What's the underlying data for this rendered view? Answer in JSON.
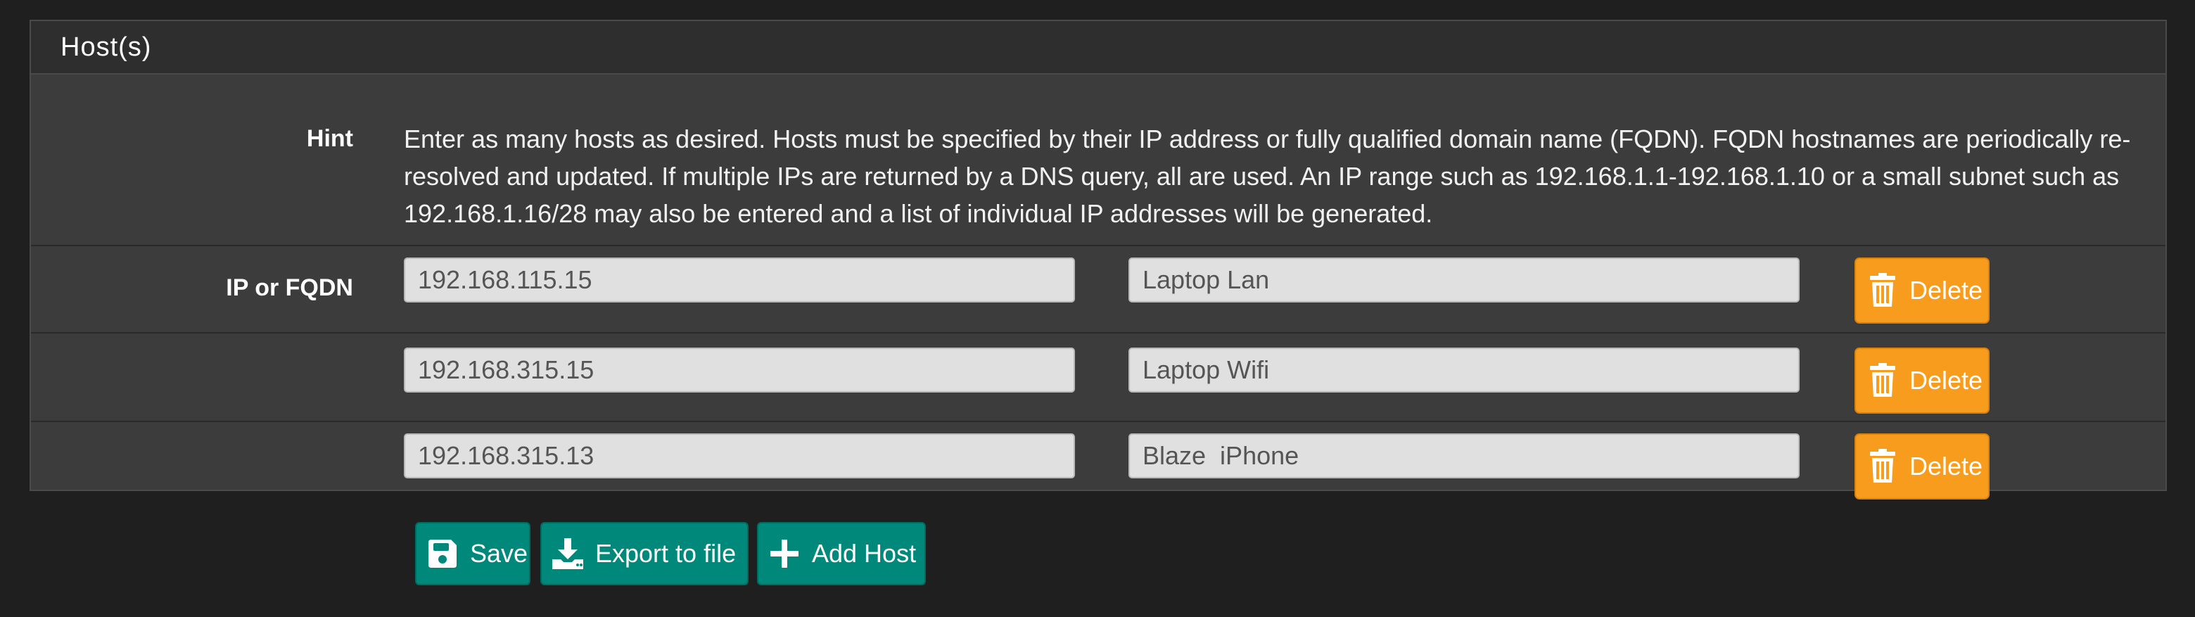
{
  "section": {
    "title": "Host(s)"
  },
  "hint": {
    "label": "Hint",
    "text": "Enter as many hosts as desired. Hosts must be specified by their IP address or fully qualified domain name (FQDN). FQDN hostnames are periodically re-resolved and updated. If multiple IPs are returned by a DNS query, all are used. An IP range such as 192.168.1.1-192.168.1.10 or a small subnet such as 192.168.1.16/28 may also be entered and a list of individual IP addresses will be generated."
  },
  "hosts": {
    "label": "IP or FQDN",
    "delete_label": "Delete",
    "rows": [
      {
        "ip": "192.168.115.15",
        "description": "Laptop Lan"
      },
      {
        "ip": "192.168.315.15",
        "description": "Laptop Wifi"
      },
      {
        "ip": "192.168.315.13",
        "description": "Blaze  iPhone"
      }
    ]
  },
  "actions": {
    "save_label": "Save",
    "export_label": "Export to file",
    "add_label": "Add Host"
  },
  "icons": {
    "delete": "trash-icon",
    "save": "floppy-disk-icon",
    "export": "download-icon",
    "add": "plus-icon"
  },
  "colors": {
    "page_background": "#1f1f1f",
    "panel_background": "#3c3c3c",
    "panel_heading": "#2e2e2e",
    "delete_button": "#f79c1d",
    "action_button": "#00897b",
    "input_background": "#e0e0e0"
  }
}
